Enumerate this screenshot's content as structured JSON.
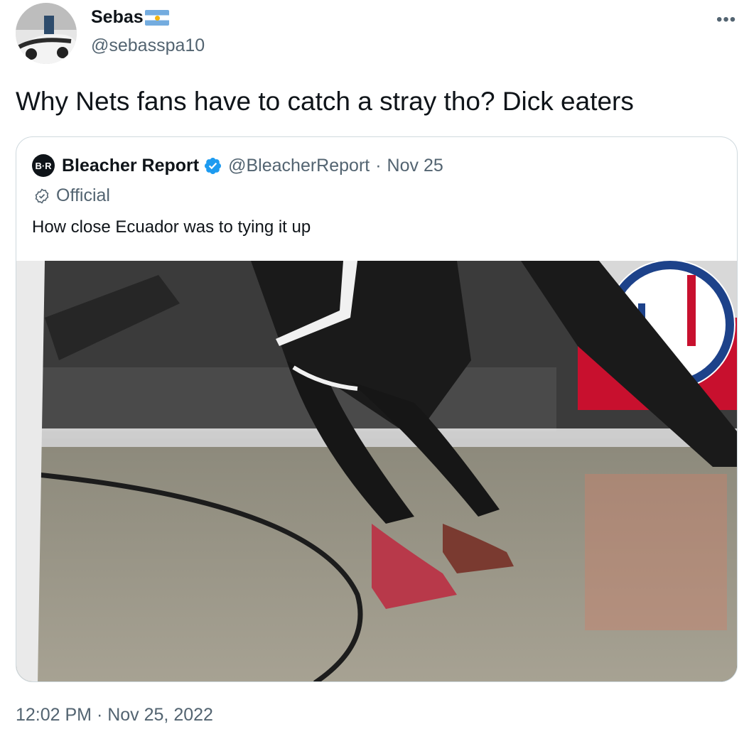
{
  "author": {
    "display_name": "Sebas",
    "handle": "@sebasspa10",
    "flag_icon": "argentina-flag-icon"
  },
  "tweet": {
    "text": "Why Nets fans have to catch a stray tho? Dick eaters",
    "timestamp": "12:02 PM · Nov 25, 2022"
  },
  "quoted_tweet": {
    "logo_text": "B·R",
    "name": "Bleacher Report",
    "handle": "@BleacherReport",
    "separator": "·",
    "date": "Nov 25",
    "badge_label": "Official",
    "text": "How close Ecuador was to tying it up"
  },
  "colors": {
    "verified_blue": "#1d9bf0",
    "secondary_text": "#536471",
    "border": "#cfd9de"
  }
}
